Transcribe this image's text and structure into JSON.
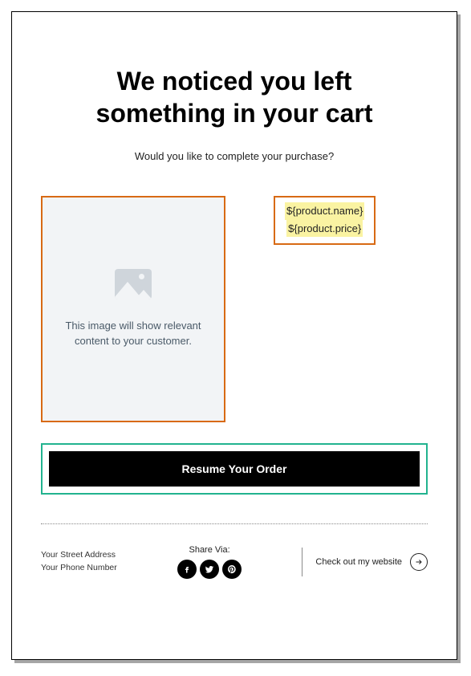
{
  "headline": "We noticed you left something in your cart",
  "subhead": "Would you like to complete your purchase?",
  "product": {
    "image_placeholder_line1": "This image will show relevant",
    "image_placeholder_line2": "content to your customer.",
    "name_token": "${product.name}",
    "price_token": "${product.price}"
  },
  "cta_label": "Resume Your Order",
  "footer": {
    "address_line1": "Your Street Address",
    "address_line2": "Your Phone Number",
    "share_label": "Share Via:",
    "website_label": "Check out my website"
  }
}
